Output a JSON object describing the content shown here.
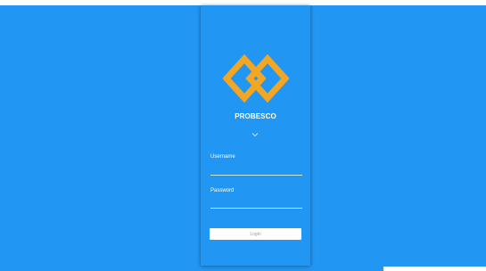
{
  "colors": {
    "background": "#2196f3",
    "logo": "#f2a623",
    "button_bg": "#ffffff",
    "button_text": "#9e9e9e"
  },
  "brand": {
    "name": "PROBESCO",
    "logo_icon": "interlocking-diamonds-logo"
  },
  "form": {
    "expand_icon": "chevron-down-icon",
    "username_label": "Username",
    "username_value": "",
    "password_label": "Password",
    "password_value": "",
    "login_label": "Login"
  }
}
